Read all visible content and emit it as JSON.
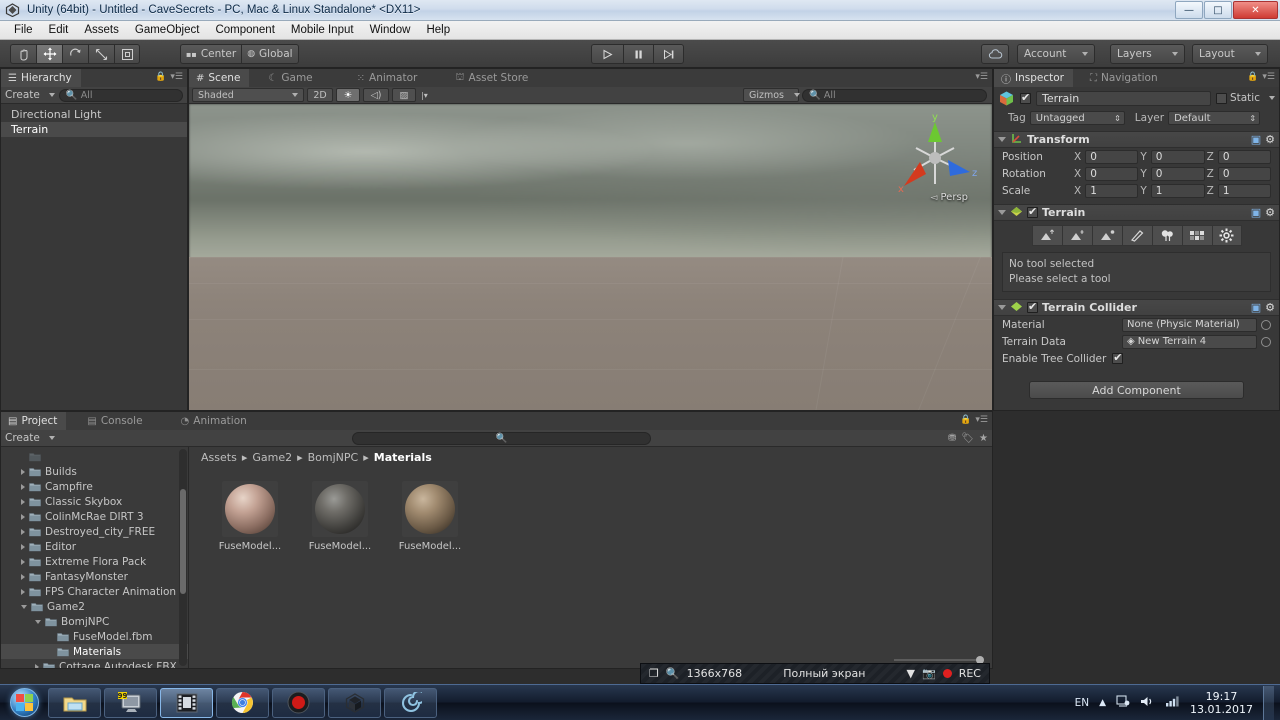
{
  "window": {
    "title": "Unity (64bit) - Untitled - CaveSecrets - PC, Mac & Linux Standalone* <DX11>",
    "minimize": "—",
    "maximize": "□",
    "close": "✕"
  },
  "menubar": [
    "File",
    "Edit",
    "Assets",
    "GameObject",
    "Component",
    "Mobile Input",
    "Window",
    "Help"
  ],
  "toolbar": {
    "tools": [
      {
        "name": "hand-tool",
        "icon": "✋"
      },
      {
        "name": "move-tool",
        "icon": "✥"
      },
      {
        "name": "rotate-tool",
        "icon": "↻"
      },
      {
        "name": "scale-tool",
        "icon": "⤢"
      },
      {
        "name": "rect-tool",
        "icon": "▣"
      }
    ],
    "pivot_label": "Center",
    "space_label": "Global",
    "play": "▶",
    "pause": "❚❚",
    "step": "▶❙",
    "cloud": "☁",
    "account_label": "Account",
    "layers_label": "Layers",
    "layout_label": "Layout"
  },
  "hierarchy": {
    "tab": "Hierarchy",
    "create_label": "Create",
    "search_placeholder": "All",
    "items": [
      {
        "label": "Directional Light",
        "selected": false
      },
      {
        "label": "Terrain",
        "selected": true
      }
    ]
  },
  "scene": {
    "tabs": [
      {
        "label": "Scene",
        "icon": "#",
        "active": true
      },
      {
        "label": "Game",
        "icon": "☾",
        "active": false
      },
      {
        "label": "Animator",
        "icon": "⁙",
        "active": false
      },
      {
        "label": "Asset Store",
        "icon": "⛫",
        "active": false
      }
    ],
    "shading_label": "Shaded",
    "mode_2d": "2D",
    "light_icon": "☀",
    "audio_icon": "◁)",
    "fx_icon": "▨",
    "gizmos_label": "Gizmos",
    "search_placeholder": "All",
    "gizmo_axes": {
      "x": "x",
      "y": "y",
      "z": "z"
    },
    "projection_label": "Persp"
  },
  "inspector": {
    "tabs": [
      {
        "label": "Inspector",
        "icon": "ⓘ",
        "active": true
      },
      {
        "label": "Navigation",
        "icon": "⛶",
        "active": false
      }
    ],
    "object_name": "Terrain",
    "object_enabled": true,
    "static_label": "Static",
    "static_checked": false,
    "tag_label": "Tag",
    "tag_value": "Untagged",
    "layer_label": "Layer",
    "layer_value": "Default",
    "transform": {
      "title": "Transform",
      "rows": [
        {
          "label": "Position",
          "x": "0",
          "y": "0",
          "z": "0"
        },
        {
          "label": "Rotation",
          "x": "0",
          "y": "0",
          "z": "0"
        },
        {
          "label": "Scale",
          "x": "1",
          "y": "1",
          "z": "1"
        }
      ],
      "axis_labels": {
        "x": "X",
        "y": "Y",
        "z": "Z"
      }
    },
    "terrain": {
      "title": "Terrain",
      "enabled": true,
      "tools": [
        "raise-lower-terrain",
        "paint-height",
        "smooth-height",
        "paint-texture",
        "place-trees",
        "paint-details",
        "terrain-settings"
      ],
      "message_line1": "No tool selected",
      "message_line2": "Please select a tool"
    },
    "terrain_collider": {
      "title": "Terrain Collider",
      "enabled": true,
      "material_label": "Material",
      "material_value": "None (Physic Material)",
      "terrain_data_label": "Terrain Data",
      "terrain_data_value": "New Terrain 4",
      "tree_collider_label": "Enable Tree Collider",
      "tree_collider_checked": true
    },
    "add_component_label": "Add Component"
  },
  "project": {
    "tabs": [
      {
        "label": "Project",
        "icon": "▤",
        "active": true
      },
      {
        "label": "Console",
        "icon": "▤",
        "active": false
      },
      {
        "label": "Animation",
        "icon": "◔",
        "active": false
      }
    ],
    "create_label": "Create",
    "tree": [
      {
        "label": "",
        "indent": 1,
        "arrow": "none",
        "partial": true
      },
      {
        "label": "Builds",
        "indent": 1,
        "arrow": "closed"
      },
      {
        "label": "Campfire",
        "indent": 1,
        "arrow": "closed"
      },
      {
        "label": "Classic Skybox",
        "indent": 1,
        "arrow": "closed"
      },
      {
        "label": "ColinMcRae DIRT 3",
        "indent": 1,
        "arrow": "closed"
      },
      {
        "label": "Destroyed_city_FREE",
        "indent": 1,
        "arrow": "closed"
      },
      {
        "label": "Editor",
        "indent": 1,
        "arrow": "closed"
      },
      {
        "label": "Extreme Flora Pack",
        "indent": 1,
        "arrow": "closed"
      },
      {
        "label": "FantasyMonster",
        "indent": 1,
        "arrow": "closed"
      },
      {
        "label": "FPS Character Animation",
        "indent": 1,
        "arrow": "closed"
      },
      {
        "label": "Game2",
        "indent": 1,
        "arrow": "open"
      },
      {
        "label": "BomjNPC",
        "indent": 2,
        "arrow": "open"
      },
      {
        "label": "FuseModel.fbm",
        "indent": 3,
        "arrow": "none"
      },
      {
        "label": "Materials",
        "indent": 3,
        "arrow": "none",
        "selected": true
      },
      {
        "label": "Cottage Autodesk FBX",
        "indent": 2,
        "arrow": "closed"
      }
    ],
    "breadcrumb": [
      "Assets",
      "Game2",
      "BomjNPC",
      "Materials"
    ],
    "breadcrumb_sep": "▸",
    "assets": [
      {
        "label": "FuseModel...",
        "preview": "light"
      },
      {
        "label": "FuseModel...",
        "preview": "dark"
      },
      {
        "label": "FuseModel...",
        "preview": "bronze"
      }
    ]
  },
  "recorder": {
    "resolution": "1366x768",
    "mode": "Полный экран",
    "rec_label": "REC",
    "camera_icon": "📷",
    "zoom_icon": "🔍",
    "window_icon": "❐",
    "caret": "▼"
  },
  "taskbar": {
    "apps": [
      {
        "name": "file-explorer",
        "active": false
      },
      {
        "name": "display-monitor",
        "active": false
      },
      {
        "name": "video-editor",
        "active": true
      },
      {
        "name": "google-chrome",
        "active": false
      },
      {
        "name": "screen-recorder",
        "active": false
      },
      {
        "name": "unity-editor",
        "active": false
      },
      {
        "name": "spiral-app",
        "active": false
      }
    ],
    "language": "EN",
    "tray_icons": [
      "chevron-up-icon",
      "action-center-icon",
      "volume-icon",
      "network-icon"
    ],
    "time": "19:17",
    "date": "13.01.2017"
  },
  "colors": {
    "unity_bg": "#383838",
    "panel_header": "#4a4a4a",
    "accent_red": "#e02020",
    "taskbar_blue": "#1a2638"
  }
}
